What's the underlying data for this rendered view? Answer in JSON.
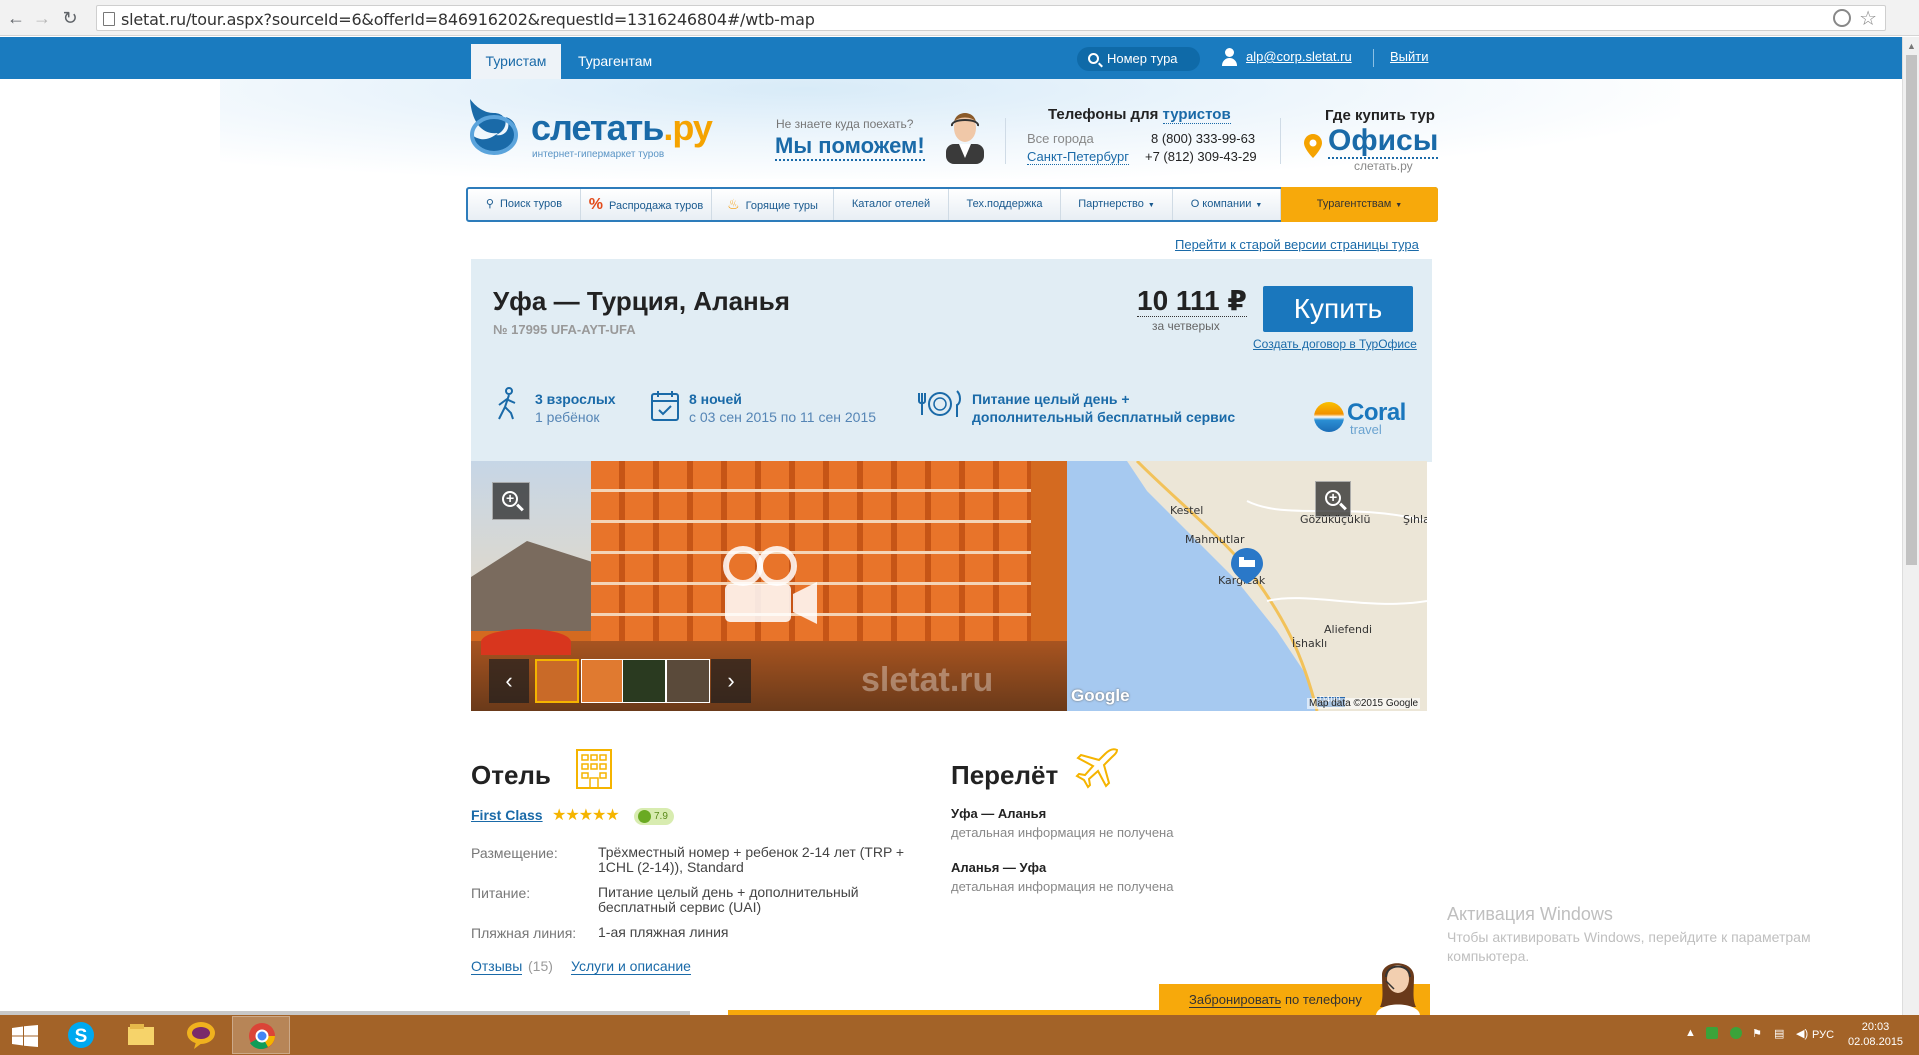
{
  "browser": {
    "url": "sletat.ru/tour.aspx?sourceId=6&offerId=846916202&requestId=1316246804#/wtb-map"
  },
  "topbar": {
    "tab_tourists": "Туристам",
    "tab_agents": "Турагентам",
    "search_label": "Номер тура",
    "user_email": "alp@corp.sletat.ru",
    "logout": "Выйти"
  },
  "header": {
    "logo_main": "слетать",
    "logo_ru": ".ру",
    "logo_sub": "интернет-гипермаркет туров",
    "help_question": "Не знаете куда поехать?",
    "help_big": "Мы поможем!",
    "phones_title": "Телефоны для",
    "phones_title_link": "туристов",
    "city1": "Все города",
    "phone1": "8 (800) 333-99-63",
    "city2": "Санкт-Петербург",
    "phone2": "+7 (812) 309-43-29",
    "where_title": "Где купить тур",
    "offices": "Офисы",
    "offices_sub": "слетать.ру"
  },
  "menu": {
    "items": [
      {
        "label": "Поиск туров"
      },
      {
        "label": "Распродажа туров"
      },
      {
        "label": "Горящие туры"
      },
      {
        "label": "Каталог отелей"
      },
      {
        "label": "Тех.поддержка"
      },
      {
        "label": "Партнерство"
      },
      {
        "label": "О компании"
      },
      {
        "label": "Турагентствам"
      }
    ]
  },
  "old_version_link": "Перейти к старой версии страницы тура",
  "tour": {
    "title": "Уфа — Турция, Аланья",
    "number": "№ 17995 UFA-AYT-UFA",
    "price": "10 111 ₽",
    "price_sub": "за четверых",
    "buy": "Купить",
    "contract_link": "Создать договор в ТурОфисе",
    "adults": "3 взрослых",
    "children": "1 ребёнок",
    "nights": "8 ночей",
    "dates": "с 03 сен 2015 по 11 сен 2015",
    "meal_line1": "Питание целый день +",
    "meal_line2": "дополнительный бесплатный сервис",
    "operator_name": "Coral",
    "operator_sub": "travel"
  },
  "gallery": {
    "watermark": "sletat.ru"
  },
  "map": {
    "labels": [
      "Kestel",
      "Mahmutlar",
      "Gözüküçüklü",
      "Şıhlar",
      "Kargıcak",
      "Aliefendi",
      "İshaklı",
      "D400"
    ],
    "google": "Google",
    "data": "Map data ©2015 Google"
  },
  "hotel": {
    "title": "Отель",
    "name": "First Class",
    "stars": "★★★★★",
    "rating": "7.9",
    "rows": [
      {
        "label": "Размещение:",
        "value": "Трёхместный номер + ребенок 2-14 лет (TRP + 1CHL (2-14)), Standard"
      },
      {
        "label": "Питание:",
        "value": "Питание целый день + дополнительный бесплатный сервис (UAI)"
      },
      {
        "label": "Пляжная линия:",
        "value": "1-ая пляжная линия"
      }
    ],
    "reviews": "Отзывы",
    "reviews_count": "(15)",
    "services": "Услуги и описание"
  },
  "flight": {
    "title": "Перелёт",
    "legs": [
      {
        "route": "Уфа — Аланья",
        "info": "детальная информация не получена"
      },
      {
        "route": "Аланья — Уфа",
        "info": "детальная информация не получена"
      }
    ]
  },
  "windows": {
    "activation_title": "Активация Windows",
    "activation_text": "Чтобы активировать Windows, перейдите к параметрам компьютера."
  },
  "booking": {
    "phone_prefix": "Забронировать",
    "phone_suffix": " по телефону"
  },
  "taskbar": {
    "lang": "РУС",
    "time": "20:03",
    "date": "02.08.2015"
  },
  "colors": {
    "brand_blue": "#1a7bbf",
    "accent_orange": "#f7a90b",
    "card_bg": "#e1edf4"
  }
}
